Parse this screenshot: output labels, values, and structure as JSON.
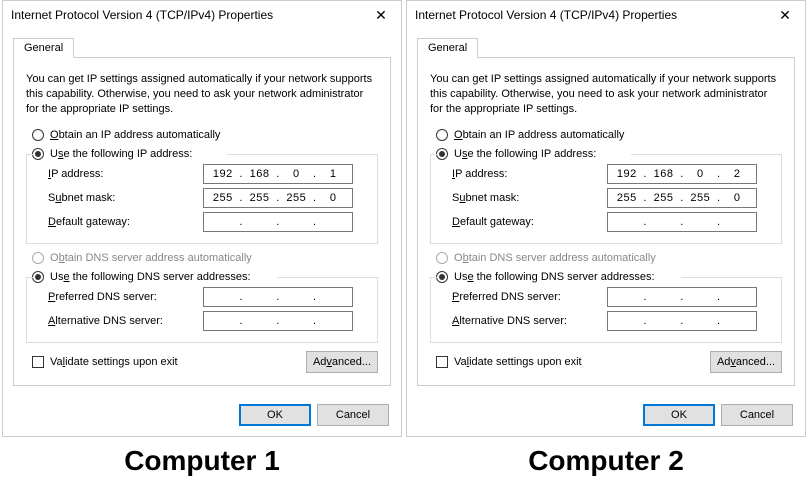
{
  "dialogs": [
    {
      "title": "Internet Protocol Version 4 (TCP/IPv4) Properties",
      "tab": "General",
      "intro": "You can get IP settings assigned automatically if your network supports this capability. Otherwise, you need to ask your network administrator for the appropriate IP settings.",
      "radio_obtain_ip": "Obtain an IP address automatically",
      "radio_use_ip": "Use the following IP address:",
      "lbl_ip": "IP address:",
      "lbl_subnet": "Subnet mask:",
      "lbl_gateway": "Default gateway:",
      "ip": [
        "192",
        "168",
        "0",
        "1"
      ],
      "subnet": [
        "255",
        "255",
        "255",
        "0"
      ],
      "gateway": [
        "",
        "",
        "",
        ""
      ],
      "radio_obtain_dns": "Obtain DNS server address automatically",
      "radio_use_dns": "Use the following DNS server addresses:",
      "lbl_pref_dns": "Preferred DNS server:",
      "lbl_alt_dns": "Alternative DNS server:",
      "pref_dns": [
        "",
        "",
        "",
        ""
      ],
      "alt_dns": [
        "",
        "",
        "",
        ""
      ],
      "chk_validate": "Validate settings upon exit",
      "btn_advanced": "Advanced...",
      "btn_ok": "OK",
      "btn_cancel": "Cancel",
      "caption": "Computer 1"
    },
    {
      "title": "Internet Protocol Version 4 (TCP/IPv4) Properties",
      "tab": "General",
      "intro": "You can get IP settings assigned automatically if your network supports this capability. Otherwise, you need to ask your network administrator for the appropriate IP settings.",
      "radio_obtain_ip": "Obtain an IP address automatically",
      "radio_use_ip": "Use the following IP address:",
      "lbl_ip": "IP address:",
      "lbl_subnet": "Subnet mask:",
      "lbl_gateway": "Default gateway:",
      "ip": [
        "192",
        "168",
        "0",
        "2"
      ],
      "subnet": [
        "255",
        "255",
        "255",
        "0"
      ],
      "gateway": [
        "",
        "",
        "",
        ""
      ],
      "radio_obtain_dns": "Obtain DNS server address automatically",
      "radio_use_dns": "Use the following DNS server addresses:",
      "lbl_pref_dns": "Preferred DNS server:",
      "lbl_alt_dns": "Alternative DNS server:",
      "pref_dns": [
        "",
        "",
        "",
        ""
      ],
      "alt_dns": [
        "",
        "",
        "",
        ""
      ],
      "chk_validate": "Validate settings upon exit",
      "btn_advanced": "Advanced...",
      "btn_ok": "OK",
      "btn_cancel": "Cancel",
      "caption": "Computer 2"
    }
  ]
}
